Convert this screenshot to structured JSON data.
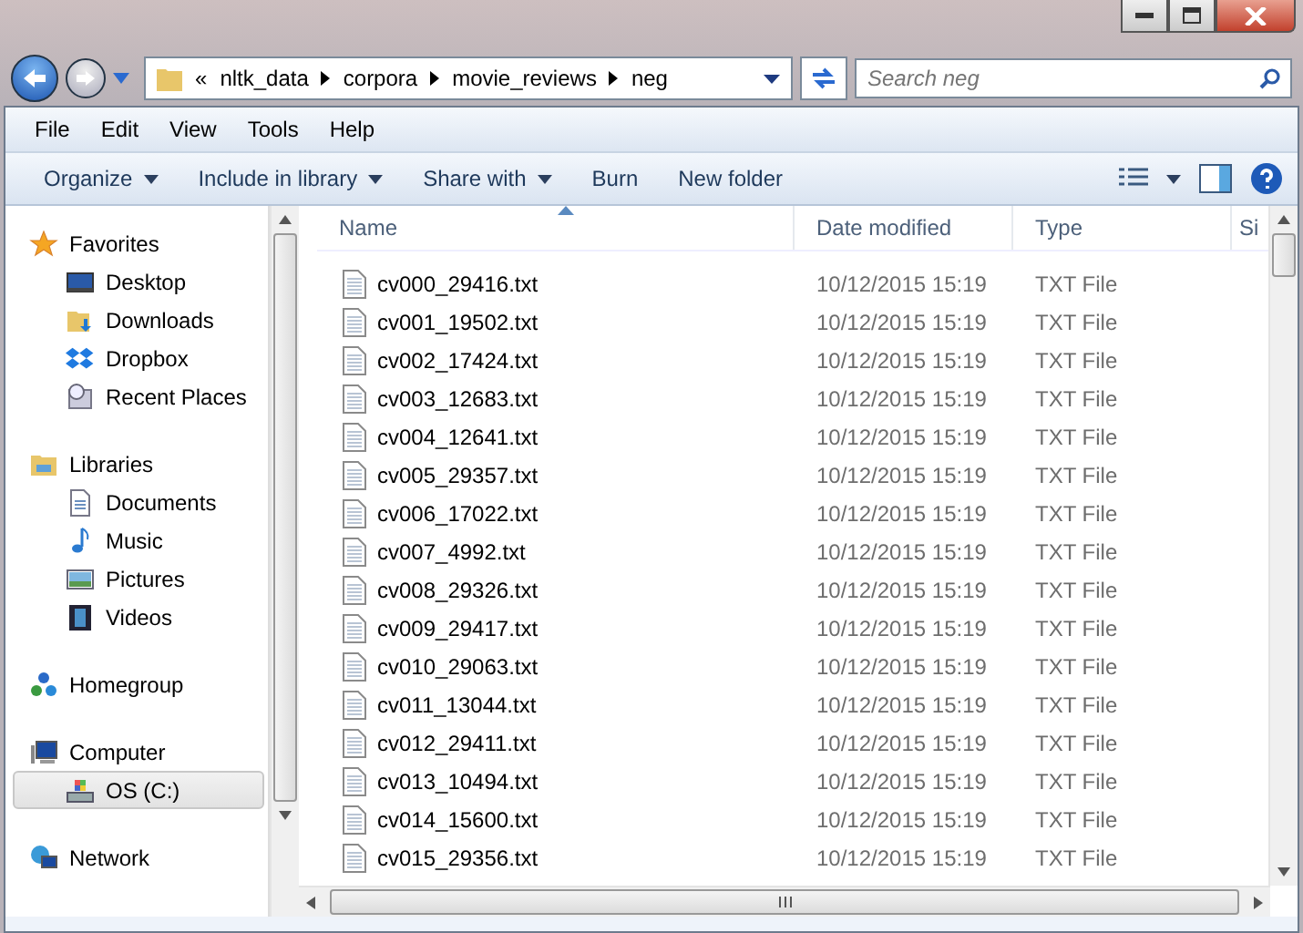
{
  "address_bar": {
    "overflow": "«",
    "crumbs": [
      "nltk_data",
      "corpora",
      "movie_reviews",
      "neg"
    ]
  },
  "search": {
    "placeholder": "Search neg"
  },
  "menu": [
    "File",
    "Edit",
    "View",
    "Tools",
    "Help"
  ],
  "toolbar": [
    {
      "label": "Organize",
      "dropdown": true
    },
    {
      "label": "Include in library",
      "dropdown": true
    },
    {
      "label": "Share with",
      "dropdown": true
    },
    {
      "label": "Burn",
      "dropdown": false
    },
    {
      "label": "New folder",
      "dropdown": false
    }
  ],
  "nav_pane": [
    {
      "label": "Favorites",
      "kind": "star",
      "selected": false,
      "children": [
        {
          "label": "Desktop",
          "kind": "desktop",
          "selected": false
        },
        {
          "label": "Downloads",
          "kind": "downloads",
          "selected": false
        },
        {
          "label": "Dropbox",
          "kind": "dropbox",
          "selected": false
        },
        {
          "label": "Recent Places",
          "kind": "recent",
          "selected": false
        }
      ]
    },
    {
      "label": "Libraries",
      "kind": "libraries",
      "selected": false,
      "children": [
        {
          "label": "Documents",
          "kind": "documents",
          "selected": false
        },
        {
          "label": "Music",
          "kind": "music",
          "selected": false
        },
        {
          "label": "Pictures",
          "kind": "pictures",
          "selected": false
        },
        {
          "label": "Videos",
          "kind": "videos",
          "selected": false
        }
      ]
    },
    {
      "label": "Homegroup",
      "kind": "homegroup",
      "selected": false
    },
    {
      "label": "Computer",
      "kind": "computer",
      "selected": false,
      "children": [
        {
          "label": "OS (C:)",
          "kind": "drive",
          "selected": true
        }
      ]
    },
    {
      "label": "Network",
      "kind": "network",
      "selected": false
    }
  ],
  "file_list": {
    "columns": [
      "Name",
      "Date modified",
      "Type",
      "Si"
    ],
    "rows": [
      {
        "name": "cv000_29416.txt",
        "date": "10/12/2015 15:19",
        "type": "TXT File"
      },
      {
        "name": "cv001_19502.txt",
        "date": "10/12/2015 15:19",
        "type": "TXT File"
      },
      {
        "name": "cv002_17424.txt",
        "date": "10/12/2015 15:19",
        "type": "TXT File"
      },
      {
        "name": "cv003_12683.txt",
        "date": "10/12/2015 15:19",
        "type": "TXT File"
      },
      {
        "name": "cv004_12641.txt",
        "date": "10/12/2015 15:19",
        "type": "TXT File"
      },
      {
        "name": "cv005_29357.txt",
        "date": "10/12/2015 15:19",
        "type": "TXT File"
      },
      {
        "name": "cv006_17022.txt",
        "date": "10/12/2015 15:19",
        "type": "TXT File"
      },
      {
        "name": "cv007_4992.txt",
        "date": "10/12/2015 15:19",
        "type": "TXT File"
      },
      {
        "name": "cv008_29326.txt",
        "date": "10/12/2015 15:19",
        "type": "TXT File"
      },
      {
        "name": "cv009_29417.txt",
        "date": "10/12/2015 15:19",
        "type": "TXT File"
      },
      {
        "name": "cv010_29063.txt",
        "date": "10/12/2015 15:19",
        "type": "TXT File"
      },
      {
        "name": "cv011_13044.txt",
        "date": "10/12/2015 15:19",
        "type": "TXT File"
      },
      {
        "name": "cv012_29411.txt",
        "date": "10/12/2015 15:19",
        "type": "TXT File"
      },
      {
        "name": "cv013_10494.txt",
        "date": "10/12/2015 15:19",
        "type": "TXT File"
      },
      {
        "name": "cv014_15600.txt",
        "date": "10/12/2015 15:19",
        "type": "TXT File"
      },
      {
        "name": "cv015_29356.txt",
        "date": "10/12/2015 15:19",
        "type": "TXT File"
      }
    ]
  }
}
